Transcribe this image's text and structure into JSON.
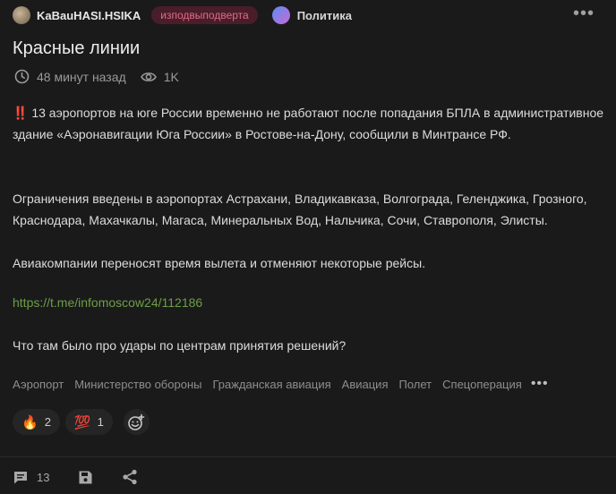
{
  "header": {
    "author": "KaBauHASI.HSIKA",
    "badge": "изподвыподверта",
    "community": "Политика",
    "more_icon": "more-dots-icon"
  },
  "post": {
    "title": "Красные линии",
    "time": "48 минут назад",
    "views": "1K",
    "paragraph1": "‼️ 13 аэропортов на юге России временно не работают после попадания БПЛА в административное здание «Аэронавигации Юга России» в Ростове-на-Дону, сообщили в Минтрансе РФ.",
    "paragraph2": "Ограничения введены в аэропортах Астрахани, Владикавказа, Волгограда, Геленджика, Грозного, Краснодара, Махачкалы, Магаса, Минеральных Вод, Нальчика, Сочи, Ставрополя, Элисты.",
    "paragraph3": "Авиакомпании переносят время вылета и отменяют некоторые рейсы.",
    "link": "https://t.me/infomoscow24/112186",
    "paragraph5": "Что там было про удары по центрам принятия решений?"
  },
  "tags": [
    "Аэропорт",
    "Министерство обороны",
    "Гражданская авиация",
    "Авиация",
    "Полет",
    "Спецоперация"
  ],
  "reactions": [
    {
      "emoji": "🔥",
      "count": "2"
    },
    {
      "emoji": "💯",
      "count": "1"
    }
  ],
  "footer": {
    "comments": "13"
  },
  "colors": {
    "background": "#1a1a1b",
    "link": "#6c9f45",
    "badge_bg": "#4a1d2a",
    "badge_text": "#e06b86"
  }
}
